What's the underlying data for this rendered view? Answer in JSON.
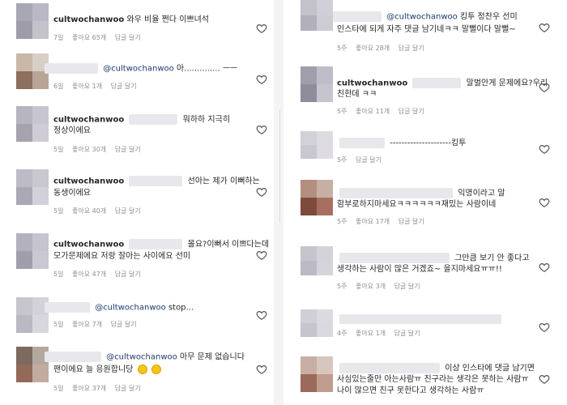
{
  "colors": {
    "username": "#262626",
    "mention": "#1e3a6e",
    "meta": "#8e8e8e"
  },
  "icons": {
    "like": "heart-outline-icon"
  },
  "left_comments": [
    {
      "user": "cultwochanwoo",
      "text": "와우 비율 쩐다 이쁘녀석",
      "text2": "",
      "mention": "",
      "time": "7일",
      "likes": "좋아요 65개",
      "reply": "답글 달기"
    },
    {
      "user": "",
      "mention": "@cultwochanwoo",
      "text": "아.............. ㅡㅡ",
      "text2": "",
      "time": "6일",
      "likes": "좋아요 1개",
      "reply": "답글 달기"
    },
    {
      "user": "cultwochanwoo",
      "mention": "",
      "text": "뭐하하 지극히",
      "text2": "정상이에요",
      "time": "5일",
      "likes": "좋아요 30개",
      "reply": "답글 달기"
    },
    {
      "user": "cultwochanwoo",
      "mention": "",
      "text": "선아는 제가 이뻐하는",
      "text2": "동생이에요",
      "time": "5일",
      "likes": "좋아요 40개",
      "reply": "답글 달기"
    },
    {
      "user": "cultwochanwoo",
      "mention": "",
      "text": "몰요?이뻐서 이쁘다는데",
      "text2": "모가문제에요 저랑 잘아는 사이에요 선미",
      "time": "5일",
      "likes": "좋아요 47개",
      "reply": "답글 달기"
    },
    {
      "user": "",
      "mention": "@cultwochanwoo",
      "text": "stop...",
      "text2": "",
      "time": "5일",
      "likes": "좋아요 7개",
      "reply": "답글 달기"
    },
    {
      "user": "",
      "mention": "@cultwochanwoo",
      "text": "아무 문제 없습니다",
      "text2": "팬이에요 늘 응원합니당",
      "time": "5일",
      "likes": "좋아요 37개",
      "reply": "답글 달기"
    }
  ],
  "right_comments": [
    {
      "user": "",
      "mention": "@cultwochanwoo",
      "text": "킹투 정찬우 선미",
      "text2": "인스타에 되게 자주 댓글 남기네ㅋㅋ 말뻘이다 말뻘~",
      "time": "5주",
      "likes": "좋아요 28개",
      "reply": "답글 달기"
    },
    {
      "user": "cultwochanwoo",
      "mention": "",
      "text": "말벌안게 문제에요?우리",
      "text2": "친한데 ㅋㅋ",
      "time": "5주",
      "likes": "좋아요 11개",
      "reply": "답글 달기"
    },
    {
      "user": "",
      "mention": "",
      "text": "---------------------킹투",
      "text2": "",
      "time": "5주",
      "likes": "",
      "reply": "답글 달기"
    },
    {
      "user": "",
      "mention": "",
      "text": "익명이라고 말",
      "text2": "함부로하지마세요ㅋㅋㅋㅋㅋㅋ재밌는 사람이네",
      "time": "5주",
      "likes": "좋아요 17개",
      "reply": "답글 달기"
    },
    {
      "user": "",
      "mention": "",
      "text": "그만큼 보기 안 좋다고",
      "text2": "생각하는 사람이 많은 거겠죠~ 을지마세요ㅠㅠ!!",
      "time": "5주",
      "likes": "좋아요 3개",
      "reply": "답글 달기"
    },
    {
      "user": "",
      "mention": "",
      "text": "",
      "text2": "",
      "time": "4주",
      "likes": "좋아요 1개",
      "reply": "답글 달기"
    },
    {
      "user": "",
      "mention": "",
      "text": "이상 인스타에 댓글 남기면",
      "text2": "사심있는줄만 아는사람ㅠ 친구라는 생각은 못하는 사람ㅠ",
      "text3": "나이 많으면 친구 못한다고 생각하는 사람ㅠ",
      "time": "",
      "likes": "",
      "reply": ""
    }
  ]
}
